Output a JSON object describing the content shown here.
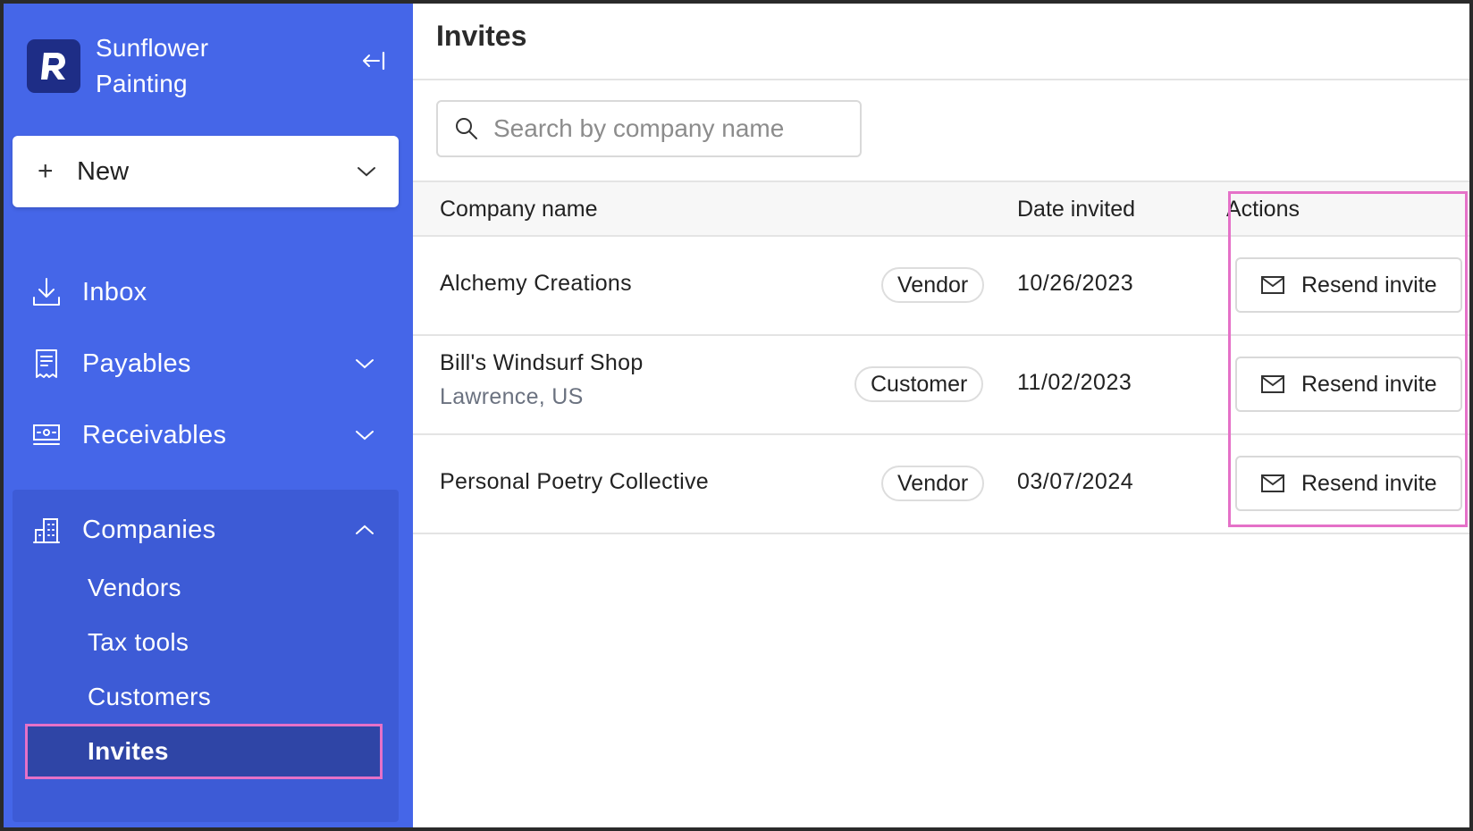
{
  "sidebar": {
    "brand": {
      "name": "Sunflower Painting",
      "logo_letter": "R"
    },
    "new_button": {
      "label": "New"
    },
    "nav": [
      {
        "label": "Inbox",
        "icon": "inbox-download-icon"
      },
      {
        "label": "Payables",
        "icon": "receipt-icon"
      },
      {
        "label": "Receivables",
        "icon": "money-icon"
      },
      {
        "label": "Companies",
        "icon": "building-icon"
      }
    ],
    "companies_sub": [
      {
        "label": "Vendors"
      },
      {
        "label": "Tax tools"
      },
      {
        "label": "Customers"
      },
      {
        "label": "Invites",
        "active": true
      }
    ]
  },
  "main": {
    "title": "Invites",
    "search": {
      "placeholder": "Search by company name",
      "value": ""
    },
    "table": {
      "headers": {
        "company": "Company name",
        "date": "Date invited",
        "actions": "Actions"
      },
      "rows": [
        {
          "company": "Alchemy Creations",
          "location": "",
          "type": "Vendor",
          "date": "10/26/2023",
          "action": "Resend invite"
        },
        {
          "company": "Bill's Windsurf Shop",
          "location": "Lawrence, US",
          "type": "Customer",
          "date": "11/02/2023",
          "action": "Resend invite"
        },
        {
          "company": "Personal Poetry Collective",
          "location": "",
          "type": "Vendor",
          "date": "03/07/2024",
          "action": "Resend invite"
        }
      ]
    }
  },
  "colors": {
    "sidebar_bg": "#4566e8",
    "sidebar_group_bg": "#3d5bd6",
    "active_item_bg": "#2f45a6",
    "highlight": "#e571c8",
    "logo_bg": "#1e2d86"
  }
}
